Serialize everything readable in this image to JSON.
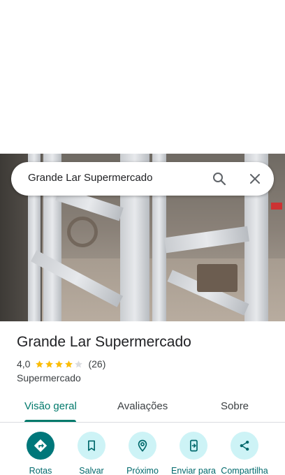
{
  "search": {
    "query": "Grande Lar Supermercado"
  },
  "place": {
    "name": "Grande Lar Supermercado",
    "rating": "4,0",
    "stars": 4,
    "reviews_count": "(26)",
    "category": "Supermercado"
  },
  "tabs": [
    {
      "label": "Visão geral",
      "active": true
    },
    {
      "label": "Avaliações",
      "active": false
    },
    {
      "label": "Sobre",
      "active": false
    }
  ],
  "actions": [
    {
      "label": "Rotas",
      "icon": "directions-icon"
    },
    {
      "label": "Salvar",
      "icon": "bookmark-icon"
    },
    {
      "label": "Próximo",
      "icon": "nearby-icon"
    },
    {
      "label": "Enviar para",
      "icon": "send-to-phone-icon"
    },
    {
      "label": "Compartilha",
      "icon": "share-icon"
    }
  ],
  "colors": {
    "accent": "#00796b",
    "action_bg": "#cdf3f6",
    "primary_action_bg": "#00777a",
    "star": "#fbbc04",
    "star_empty": "#dadce0"
  }
}
